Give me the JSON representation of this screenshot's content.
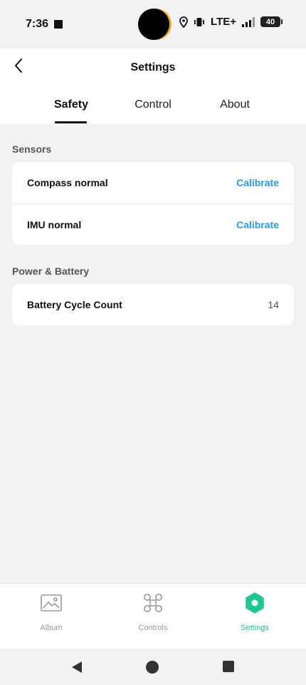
{
  "status_bar": {
    "time": "7:36",
    "network": "LTE+",
    "battery_level": "40"
  },
  "header": {
    "title": "Settings",
    "tabs": [
      {
        "label": "Safety",
        "active": true
      },
      {
        "label": "Control",
        "active": false
      },
      {
        "label": "About",
        "active": false
      }
    ]
  },
  "sections": {
    "sensors": {
      "title": "Sensors",
      "rows": [
        {
          "label": "Compass normal",
          "action": "Calibrate"
        },
        {
          "label": "IMU normal",
          "action": "Calibrate"
        }
      ]
    },
    "power": {
      "title": "Power & Battery",
      "rows": [
        {
          "label": "Battery Cycle Count",
          "value": "14"
        }
      ]
    }
  },
  "bottom_nav": {
    "items": [
      {
        "label": "Album",
        "icon": "image-icon"
      },
      {
        "label": "Controls",
        "icon": "drone-icon"
      },
      {
        "label": "Settings",
        "icon": "hexagon-settings-icon",
        "active": true
      }
    ]
  },
  "colors": {
    "accent_blue": "#2a9bdc",
    "active_green": "#1fc78f",
    "background": "#f2f2f2"
  }
}
